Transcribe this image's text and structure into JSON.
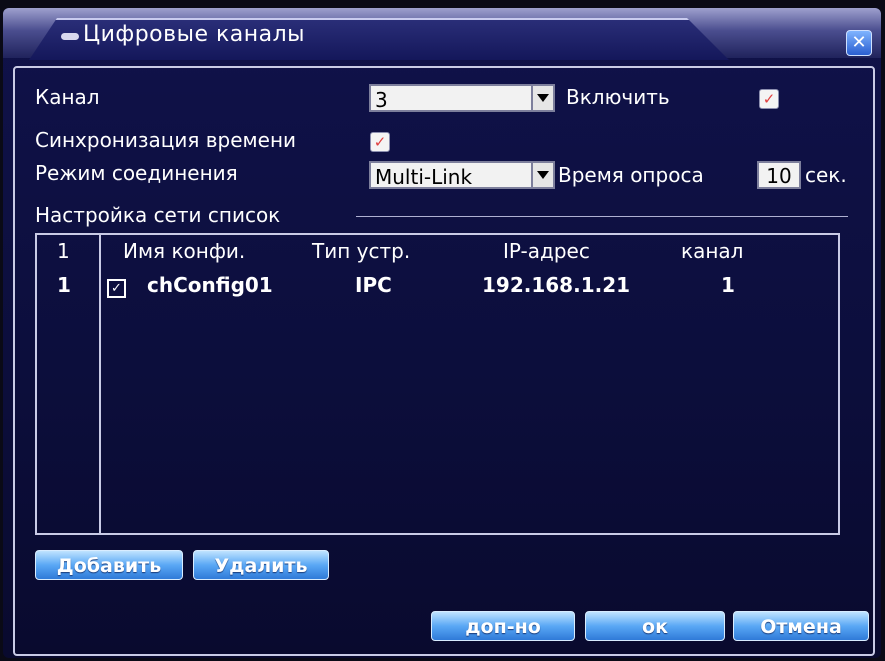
{
  "window": {
    "title": "Цифровые каналы"
  },
  "form": {
    "channel_label": "Канал",
    "channel_value": "3",
    "enable_label": "Включить",
    "enable_checked": true,
    "timesync_label": "Синхронизация времени",
    "timesync_checked": true,
    "conn_mode_label": "Режим соединения",
    "conn_mode_value": "Multi-Link",
    "poll_time_label": "Время опроса",
    "poll_time_value": "10",
    "poll_time_unit": "сек."
  },
  "list": {
    "section_title": "Настройка сети список",
    "headers": [
      "1",
      "Имя конфи.",
      "Тип устр.",
      "IP-адрес",
      "канал"
    ],
    "rows": [
      {
        "index": "1",
        "checked": true,
        "name": "chConfig01",
        "type": "IPC",
        "ip": "192.168.1.21",
        "channel": "1"
      }
    ]
  },
  "buttons": {
    "add": "Добавить",
    "delete": "Удалить",
    "advanced": "доп-но",
    "ok": "ок",
    "cancel": "Отмена"
  },
  "icons": {
    "close": "close-icon",
    "checkmark": "checkmark-icon",
    "dropdown": "chevron-down-icon"
  },
  "colors": {
    "background": "#0c0e3c",
    "button": "#5aa8f5",
    "check": "#e04040"
  }
}
